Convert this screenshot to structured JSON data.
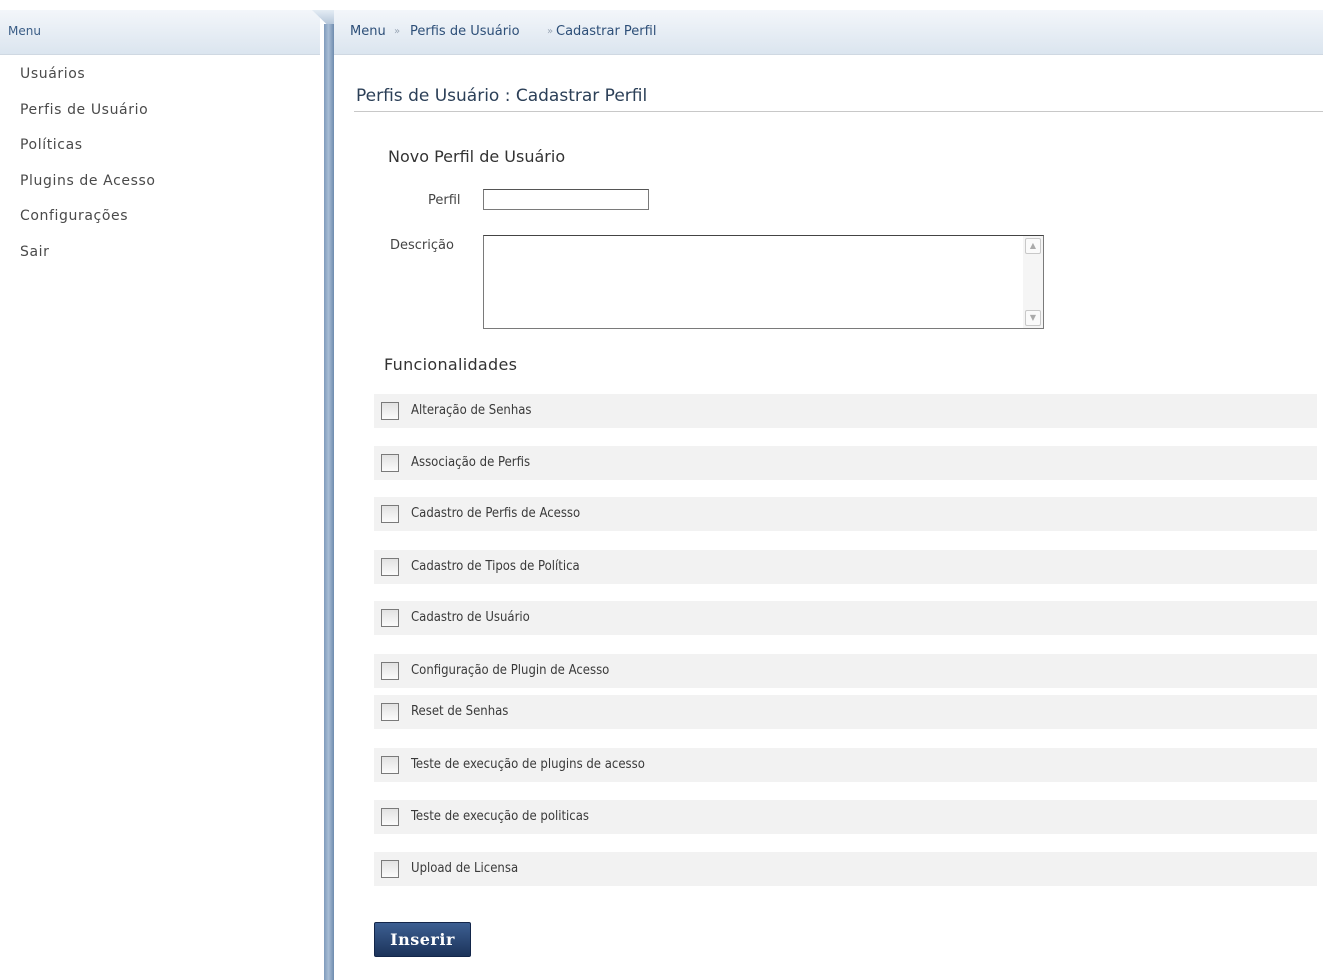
{
  "sidebar": {
    "header": "Menu",
    "items": [
      {
        "label": "Usuários"
      },
      {
        "label": "Perfis de Usuário"
      },
      {
        "label": "Políticas"
      },
      {
        "label": "Plugins de Acesso"
      },
      {
        "label": "Configurações"
      },
      {
        "label": "Sair"
      }
    ]
  },
  "breadcrumb": {
    "menu": "Menu",
    "sep": "»",
    "perfis": "Perfis de Usuário",
    "sep2": "»",
    "current": "Cadastrar Perfil"
  },
  "page": {
    "title": "Perfis de Usuário : Cadastrar Perfil",
    "section_title": "Novo Perfil de Usuário",
    "perfil_label": "Perfil",
    "perfil_value": "",
    "descricao_label": "Descrição",
    "descricao_value": "",
    "funcionalidades_title": "Funcionalidades",
    "insert_label": "Inserir"
  },
  "funcionalidades": [
    {
      "label": "Alteração de Senhas",
      "checked": false
    },
    {
      "label": "Associação de Perfis",
      "checked": false
    },
    {
      "label": "Cadastro de Perfis de Acesso",
      "checked": false
    },
    {
      "label": "Cadastro de Tipos de Política",
      "checked": false
    },
    {
      "label": "Cadastro de Usuário",
      "checked": false
    },
    {
      "label": "Configuração de Plugin de Acesso",
      "checked": false
    },
    {
      "label": "Reset de Senhas",
      "checked": false
    },
    {
      "label": "Teste de execução de plugins de acesso",
      "checked": false
    },
    {
      "label": "Teste de execução de politicas",
      "checked": false
    },
    {
      "label": "Upload de Licensa",
      "checked": false
    }
  ],
  "icons": {
    "scroll_up": "chevron-up-icon",
    "scroll_down": "chevron-down-icon"
  },
  "colors": {
    "header_gradient_top": "#f3f6fa",
    "header_gradient_bottom": "#dbe5ef",
    "button_blue": "#2a4677",
    "separator_blue": "#8aa3c2",
    "row_bg": "#f2f2f2"
  }
}
